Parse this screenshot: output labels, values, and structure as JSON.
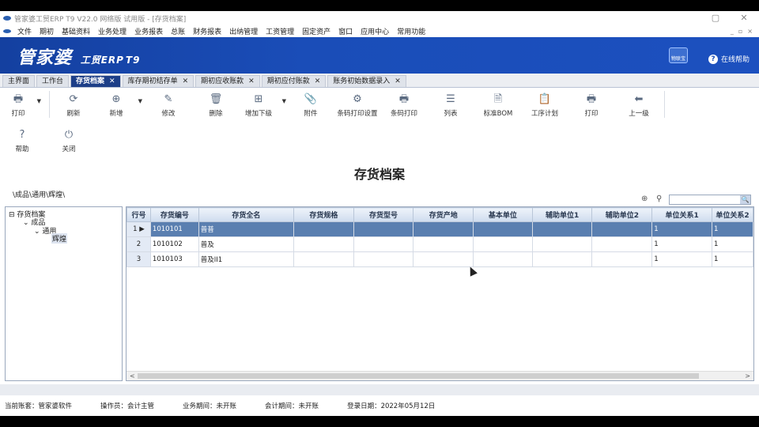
{
  "window": {
    "title": "管家婆工贸ERP T9 V22.0 网络版 试用版 - [存货档案]",
    "min": "▢",
    "close": "✕"
  },
  "menu": [
    "文件",
    "期初",
    "基础资料",
    "业务处理",
    "业务报表",
    "总账",
    "财务报表",
    "出纳管理",
    "工资管理",
    "固定资产",
    "窗口",
    "应用中心",
    "常用功能"
  ],
  "menu_right": [
    "_",
    "▫",
    "×"
  ],
  "banner": {
    "brand": "管家婆",
    "sub": "工贸ERP",
    "ver": "T9",
    "wlogo": "物联宝",
    "help": "在线帮助"
  },
  "tabs": [
    {
      "label": "主界面",
      "closable": false,
      "active": false
    },
    {
      "label": "工作台",
      "closable": false,
      "active": false
    },
    {
      "label": "存货档案",
      "closable": true,
      "active": true
    },
    {
      "label": "库存期初结存单",
      "closable": true,
      "active": false
    },
    {
      "label": "期初应收账款",
      "closable": true,
      "active": false
    },
    {
      "label": "期初应付账款",
      "closable": true,
      "active": false
    },
    {
      "label": "账务初始数据录入",
      "closable": true,
      "active": false
    }
  ],
  "toolbar": {
    "print": "打印",
    "refresh": "刷新",
    "add": "新增",
    "edit": "修改",
    "delete": "删除",
    "add_child": "增加下级",
    "attach": "附件",
    "barcode_setup": "条码打印设置",
    "barcode_print": "条码打印",
    "list": "列表",
    "bom": "标准BOM",
    "process": "工序计划",
    "print2": "打印",
    "up": "上一级",
    "help": "帮助",
    "close": "关闭"
  },
  "page": {
    "title": "存货档案",
    "path": "\\成品\\通用\\辉煌\\"
  },
  "tree": {
    "root": "存货档案",
    "l1": "成品",
    "l2": "通用",
    "l3": "辉煌"
  },
  "grid": {
    "columns": [
      "行号",
      "存货编号",
      "存货全名",
      "存货规格",
      "存货型号",
      "存货产地",
      "基本单位",
      "辅助单位1",
      "辅助单位2",
      "单位关系1",
      "单位关系2"
    ],
    "rows": [
      {
        "n": "1",
        "code": "1010101",
        "name": "普普",
        "r1": "1",
        "r2": "1"
      },
      {
        "n": "2",
        "code": "1010102",
        "name": "普及",
        "r1": "1",
        "r2": "1"
      },
      {
        "n": "3",
        "code": "1010103",
        "name": "普及II1",
        "r1": "1",
        "r2": "1"
      }
    ]
  },
  "status": {
    "account": "当前账套：管家婆软件",
    "operator": "操作员：会计主管",
    "biz_period": "业务期间：未开账",
    "acc_period": "会计期间：未开账",
    "login": "登录日期：2022年05月12日"
  }
}
